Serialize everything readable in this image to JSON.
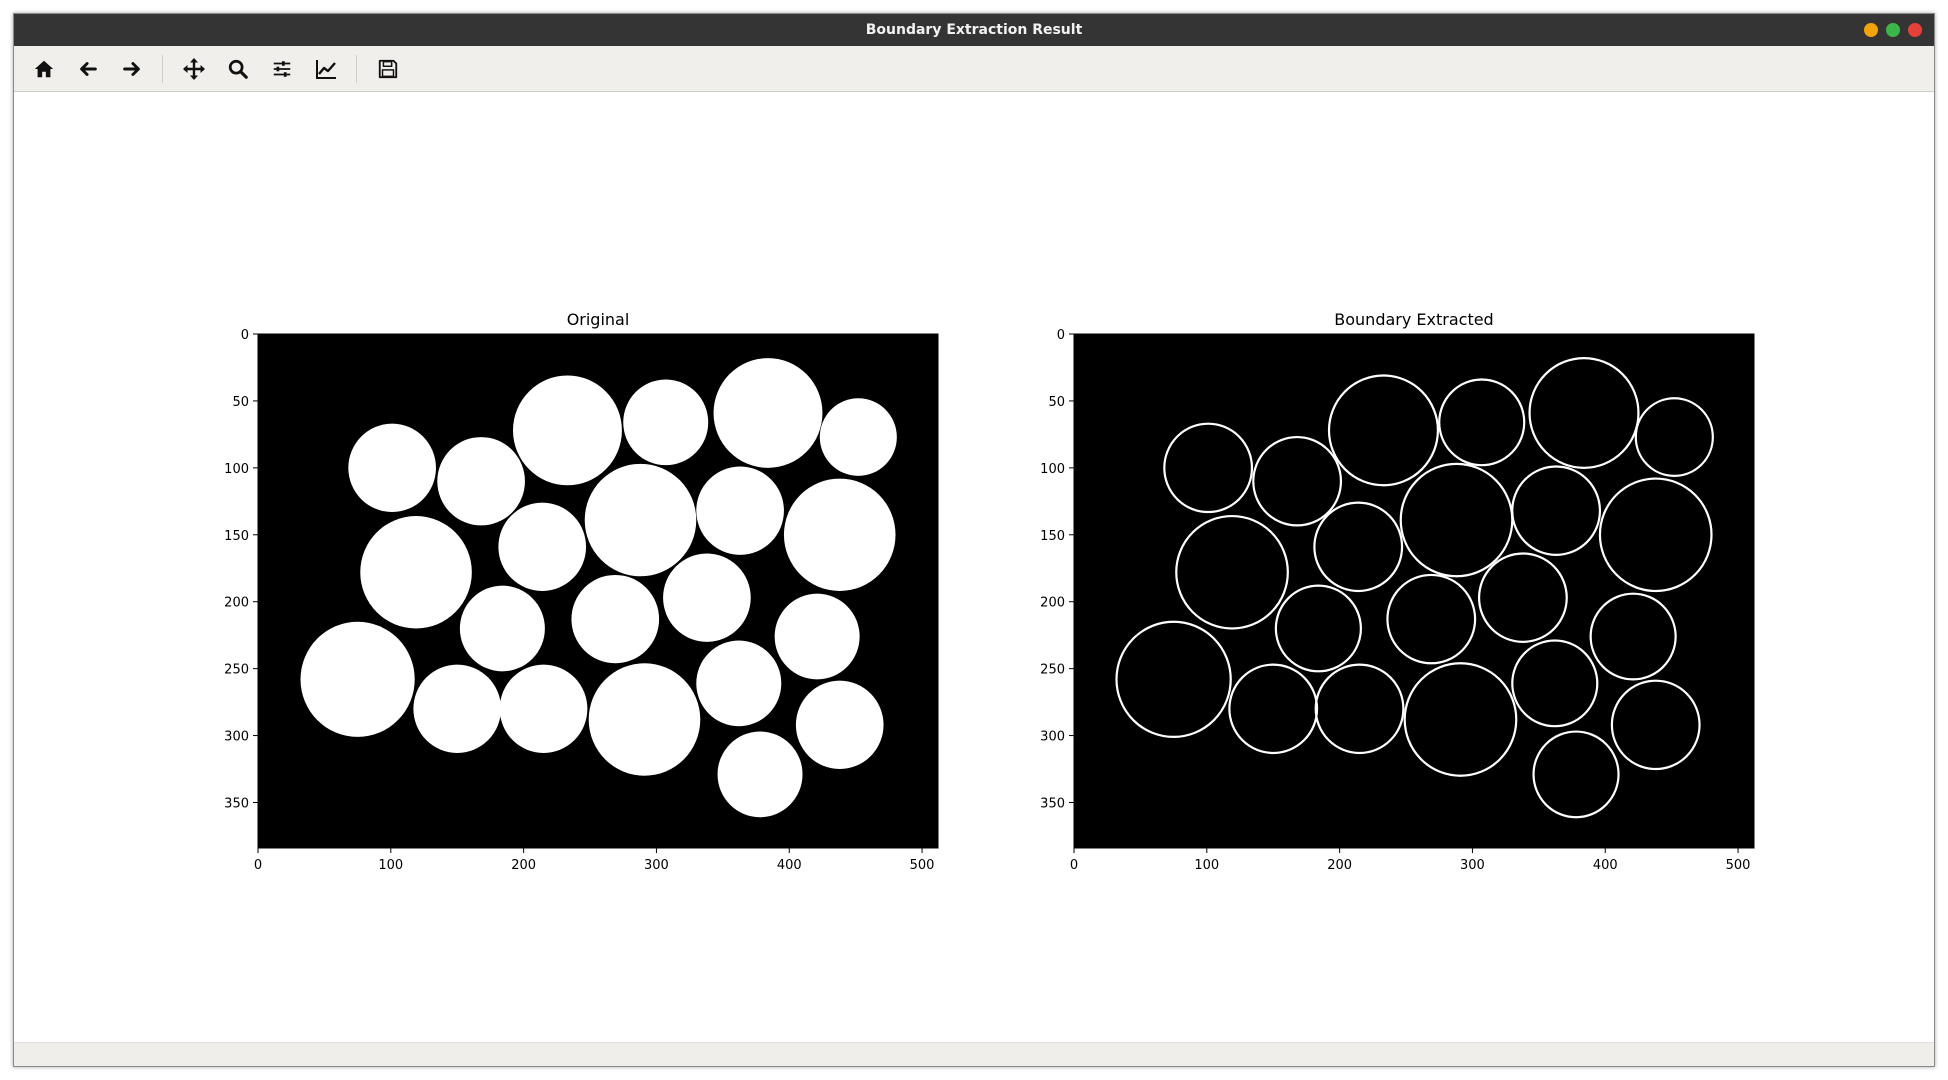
{
  "window": {
    "title": "Boundary Extraction Result",
    "controls": [
      "minimize",
      "maximize",
      "close"
    ],
    "control_colors": {
      "minimize": "#f0a30a",
      "maximize": "#3cb64a",
      "close": "#e5413a"
    }
  },
  "toolbar": {
    "buttons": [
      {
        "name": "home-button",
        "icon": "home-icon"
      },
      {
        "name": "back-button",
        "icon": "arrow-left-icon"
      },
      {
        "name": "forward-button",
        "icon": "arrow-right-icon"
      },
      {
        "name": "pan-button",
        "icon": "move-icon"
      },
      {
        "name": "zoom-button",
        "icon": "magnifier-icon"
      },
      {
        "name": "configure-subplots-button",
        "icon": "sliders-icon"
      },
      {
        "name": "edit-axis-button",
        "icon": "line-chart-icon"
      },
      {
        "name": "save-button",
        "icon": "floppy-disk-icon"
      }
    ]
  },
  "figure": {
    "left_panel": {
      "title": "Original",
      "xticks": [
        "0",
        "100",
        "200",
        "300",
        "400",
        "500"
      ],
      "yticks": [
        "0",
        "50",
        "100",
        "150",
        "200",
        "250",
        "300",
        "350"
      ]
    },
    "right_panel": {
      "title": "Boundary Extracted",
      "xticks": [
        "0",
        "100",
        "200",
        "300",
        "400",
        "500"
      ],
      "yticks": [
        "0",
        "50",
        "100",
        "150",
        "200",
        "250",
        "300",
        "350"
      ]
    },
    "image_width": 512,
    "image_height": 384,
    "circles": [
      {
        "cx": 101,
        "cy": 100,
        "r": 33
      },
      {
        "cx": 168,
        "cy": 110,
        "r": 33
      },
      {
        "cx": 233,
        "cy": 72,
        "r": 41
      },
      {
        "cx": 307,
        "cy": 66,
        "r": 32
      },
      {
        "cx": 384,
        "cy": 59,
        "r": 41
      },
      {
        "cx": 452,
        "cy": 77,
        "r": 29
      },
      {
        "cx": 119,
        "cy": 178,
        "r": 42
      },
      {
        "cx": 214,
        "cy": 159,
        "r": 33
      },
      {
        "cx": 288,
        "cy": 139,
        "r": 42
      },
      {
        "cx": 363,
        "cy": 132,
        "r": 33
      },
      {
        "cx": 438,
        "cy": 150,
        "r": 42
      },
      {
        "cx": 184,
        "cy": 220,
        "r": 32
      },
      {
        "cx": 269,
        "cy": 213,
        "r": 33
      },
      {
        "cx": 338,
        "cy": 197,
        "r": 33
      },
      {
        "cx": 421,
        "cy": 226,
        "r": 32
      },
      {
        "cx": 75,
        "cy": 258,
        "r": 43
      },
      {
        "cx": 150,
        "cy": 280,
        "r": 33
      },
      {
        "cx": 215,
        "cy": 280,
        "r": 33
      },
      {
        "cx": 291,
        "cy": 288,
        "r": 42
      },
      {
        "cx": 362,
        "cy": 261,
        "r": 32
      },
      {
        "cx": 438,
        "cy": 292,
        "r": 33
      },
      {
        "cx": 378,
        "cy": 329,
        "r": 32
      }
    ]
  }
}
